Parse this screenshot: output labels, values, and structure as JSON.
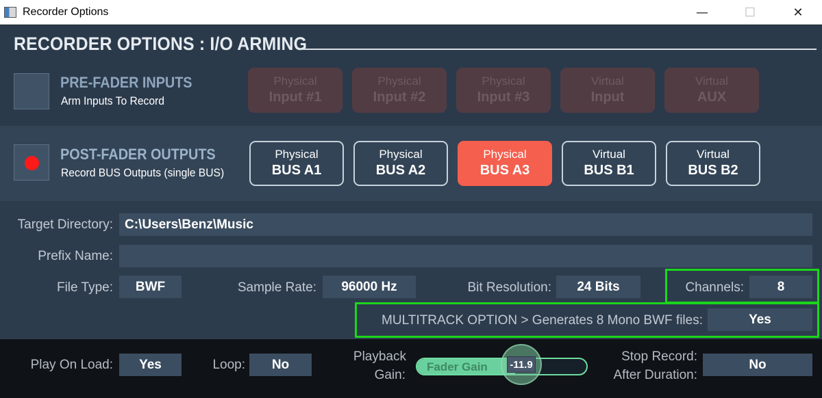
{
  "window": {
    "title": "Recorder Options",
    "minimize": "—",
    "maximize": "☐",
    "close": "✕"
  },
  "header": {
    "title": "RECORDER OPTIONS : I/O ARMING"
  },
  "pre_fader": {
    "title": "PRE-FADER INPUTS",
    "subtitle": "Arm Inputs To Record",
    "armed": false,
    "buttons": [
      {
        "line1": "Physical",
        "line2": "Input #1"
      },
      {
        "line1": "Physical",
        "line2": "Input #2"
      },
      {
        "line1": "Physical",
        "line2": "Input #3"
      },
      {
        "line1": "Virtual",
        "line2": "Input"
      },
      {
        "line1": "Virtual",
        "line2": "AUX"
      }
    ]
  },
  "post_fader": {
    "title": "POST-FADER OUTPUTS",
    "subtitle": "Record BUS Outputs (single BUS)",
    "armed": true,
    "buttons": [
      {
        "line1": "Physical",
        "line2": "BUS A1",
        "active": false
      },
      {
        "line1": "Physical",
        "line2": "BUS A2",
        "active": false
      },
      {
        "line1": "Physical",
        "line2": "BUS A3",
        "active": true
      },
      {
        "line1": "Virtual",
        "line2": "BUS B1",
        "active": false
      },
      {
        "line1": "Virtual",
        "line2": "BUS B2",
        "active": false
      }
    ]
  },
  "form": {
    "target_directory_label": "Target Directory:",
    "target_directory_value": "C:\\Users\\Benz\\Music",
    "prefix_name_label": "Prefix Name:",
    "prefix_name_value": "",
    "file_type_label": "File Type:",
    "file_type_value": "BWF",
    "sample_rate_label": "Sample Rate:",
    "sample_rate_value": "96000 Hz",
    "bit_resolution_label": "Bit Resolution:",
    "bit_resolution_value": "24 Bits",
    "channels_label": "Channels:",
    "channels_value": "8",
    "multitrack_label": "MULTITRACK OPTION > Generates 8 Mono BWF files:",
    "multitrack_value": "Yes"
  },
  "bottom": {
    "play_on_load_label": "Play On Load:",
    "play_on_load_value": "Yes",
    "loop_label": "Loop:",
    "loop_value": "No",
    "playback_gain_label_1": "Playback",
    "playback_gain_label_2": "Gain:",
    "fader_text": "Fader Gain",
    "fader_value": "-11.9",
    "fader_fill_fraction": 0.58,
    "stop_record_label_1": "Stop Record:",
    "stop_record_label_2": "After Duration:",
    "stop_record_value": "No"
  },
  "colors": {
    "accent_active": "#f55f4e",
    "highlight": "#1bd61b",
    "fader": "#6ad19e",
    "arm_dot": "#ff1a1a"
  }
}
